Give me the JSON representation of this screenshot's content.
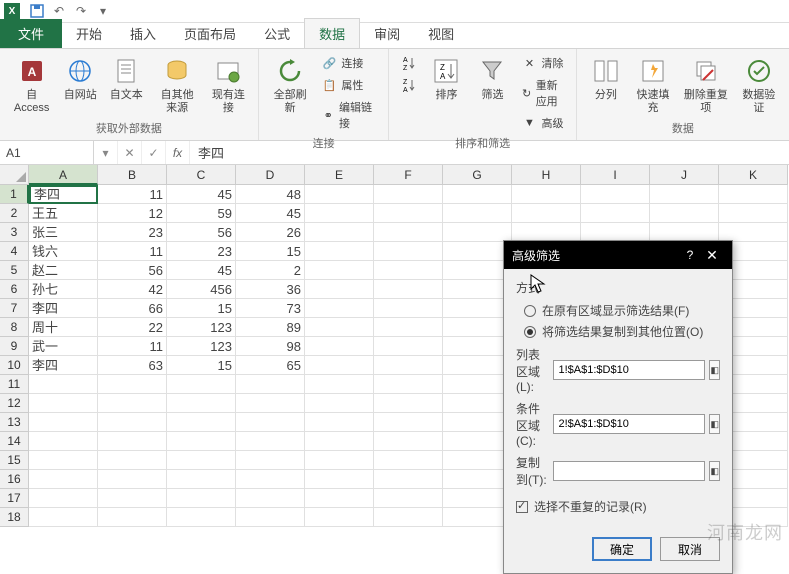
{
  "tabs": {
    "file": "文件",
    "home": "开始",
    "insert": "插入",
    "layout": "页面布局",
    "formulas": "公式",
    "data": "数据",
    "review": "审阅",
    "view": "视图"
  },
  "ribbon": {
    "ext_data": {
      "access": "自 Access",
      "web": "自网站",
      "text": "自文本",
      "other": "自其他来源",
      "existing": "现有连接",
      "label": "获取外部数据"
    },
    "conn": {
      "refresh": "全部刷新",
      "connections": "连接",
      "properties": "属性",
      "edit_links": "编辑链接",
      "label": "连接"
    },
    "sort": {
      "sort": "排序",
      "filter": "筛选",
      "clear": "清除",
      "reapply": "重新应用",
      "advanced": "高级",
      "label": "排序和筛选"
    },
    "tools": {
      "text_to_col": "分列",
      "flash_fill": "快速填充",
      "remove_dup": "删除重复项",
      "validation": "数据验证",
      "label": "数据"
    }
  },
  "name_box": "A1",
  "formula_value": "李四",
  "columns": [
    "A",
    "B",
    "C",
    "D",
    "E",
    "F",
    "G",
    "H",
    "I",
    "J",
    "K"
  ],
  "rows": [
    {
      "n": "1",
      "a": "李四",
      "b": "11",
      "c": "45",
      "d": "48"
    },
    {
      "n": "2",
      "a": "王五",
      "b": "12",
      "c": "59",
      "d": "45"
    },
    {
      "n": "3",
      "a": "张三",
      "b": "23",
      "c": "56",
      "d": "26"
    },
    {
      "n": "4",
      "a": "钱六",
      "b": "11",
      "c": "23",
      "d": "15"
    },
    {
      "n": "5",
      "a": "赵二",
      "b": "56",
      "c": "45",
      "d": "2"
    },
    {
      "n": "6",
      "a": "孙七",
      "b": "42",
      "c": "456",
      "d": "36"
    },
    {
      "n": "7",
      "a": "李四",
      "b": "66",
      "c": "15",
      "d": "73"
    },
    {
      "n": "8",
      "a": "周十",
      "b": "22",
      "c": "123",
      "d": "89"
    },
    {
      "n": "9",
      "a": "武一",
      "b": "11",
      "c": "123",
      "d": "98"
    },
    {
      "n": "10",
      "a": "李四",
      "b": "63",
      "c": "15",
      "d": "65"
    },
    {
      "n": "11"
    },
    {
      "n": "12"
    },
    {
      "n": "13"
    },
    {
      "n": "14"
    },
    {
      "n": "15"
    },
    {
      "n": "16"
    },
    {
      "n": "17"
    },
    {
      "n": "18"
    }
  ],
  "dialog": {
    "title": "高级筛选",
    "method": "方式",
    "radio1": "在原有区域显示筛选结果(F)",
    "radio2": "将筛选结果复制到其他位置(O)",
    "list_range_label": "列表区域(L):",
    "list_range_value": "1!$A$1:$D$10",
    "criteria_label": "条件区域(C):",
    "criteria_value": "2!$A$1:$D$10",
    "copy_to_label": "复制到(T):",
    "copy_to_value": "",
    "unique": "选择不重复的记录(R)",
    "ok": "确定",
    "cancel": "取消"
  },
  "watermark": "河南龙网"
}
